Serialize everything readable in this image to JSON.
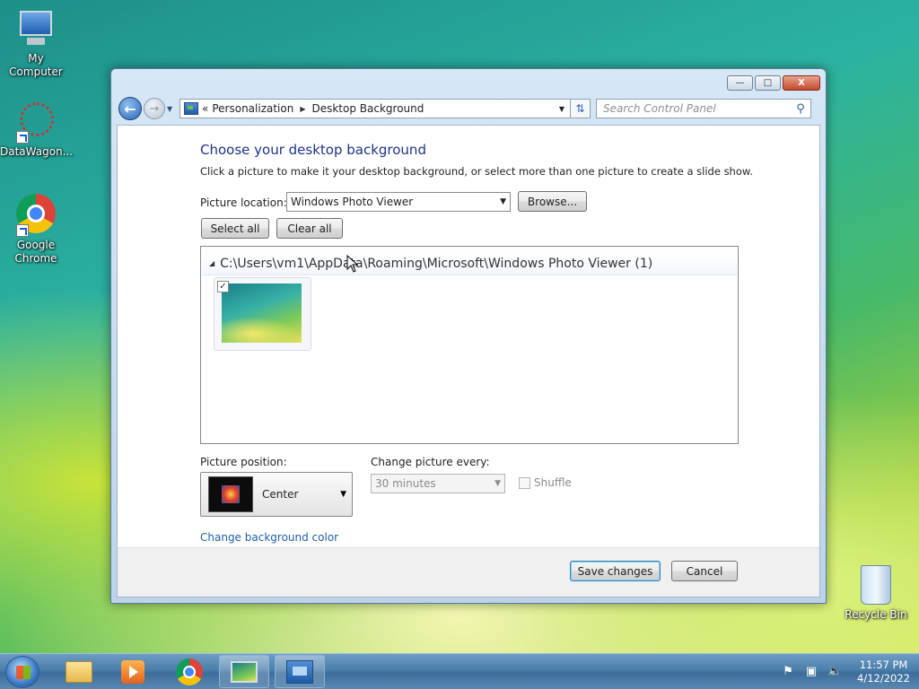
{
  "desktop": {
    "icons": [
      {
        "label": "My Computer"
      },
      {
        "label": "DataWagon..."
      },
      {
        "label": "Google\nChrome"
      }
    ],
    "recycle_bin": "Recycle Bin"
  },
  "window": {
    "caption_buttons": {
      "minimize": "—",
      "maximize": "□",
      "close": "X"
    },
    "address": {
      "prefix": "«",
      "crumbs": [
        "Personalization",
        "Desktop Background"
      ]
    },
    "search": {
      "placeholder": "Search Control Panel"
    },
    "heading": "Choose your desktop background",
    "description": "Click a picture to make it your desktop background, or select more than one picture to create a slide show.",
    "picture_location_label": "Picture location:",
    "picture_location_value": "Windows Photo Viewer",
    "browse_label": "Browse...",
    "select_all_label": "Select all",
    "clear_all_label": "Clear all",
    "group_header": "C:\\Users\\vm1\\AppData\\Roaming\\Microsoft\\Windows Photo Viewer (1)",
    "thumbnail_checked": true,
    "picture_position_label": "Picture position:",
    "picture_position_value": "Center",
    "change_every_label": "Change picture every:",
    "change_every_value": "30 minutes",
    "shuffle_label": "Shuffle",
    "change_color_link": "Change background color",
    "save_label": "Save changes",
    "cancel_label": "Cancel"
  },
  "taskbar": {
    "time": "11:57 PM",
    "date": "4/12/2022"
  },
  "colors": {
    "heading": "#1e3287",
    "link": "#1f5ea8",
    "taskbar": "#4b7eab"
  }
}
